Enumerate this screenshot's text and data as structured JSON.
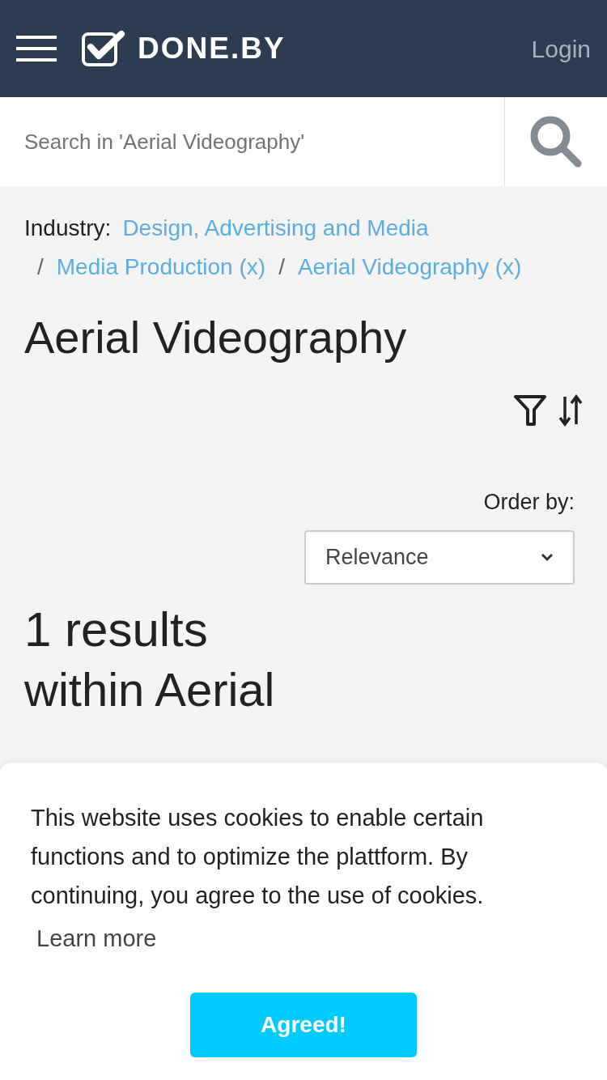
{
  "header": {
    "logo": "DONE.BY",
    "login": "Login"
  },
  "search": {
    "placeholder": "Search in 'Aerial Videography'"
  },
  "breadcrumb": {
    "label": "Industry:",
    "items": [
      {
        "text": "Design, Advertising and Media"
      },
      {
        "separator": "/",
        "text": "Media Production (x)"
      },
      {
        "separator": "/",
        "text": "Aerial Videography (x)"
      }
    ]
  },
  "title": "Aerial Videography",
  "order": {
    "label": "Order by:",
    "value": "Relevance"
  },
  "results": {
    "count": "1 results",
    "scope": "within Aerial"
  },
  "cookie_banner": {
    "text": "This website uses cookies to enable certain functions and to optimize the plattform. By continuing, you agree to the use of cookies.",
    "link": "Learn more",
    "button": "Agreed!"
  }
}
